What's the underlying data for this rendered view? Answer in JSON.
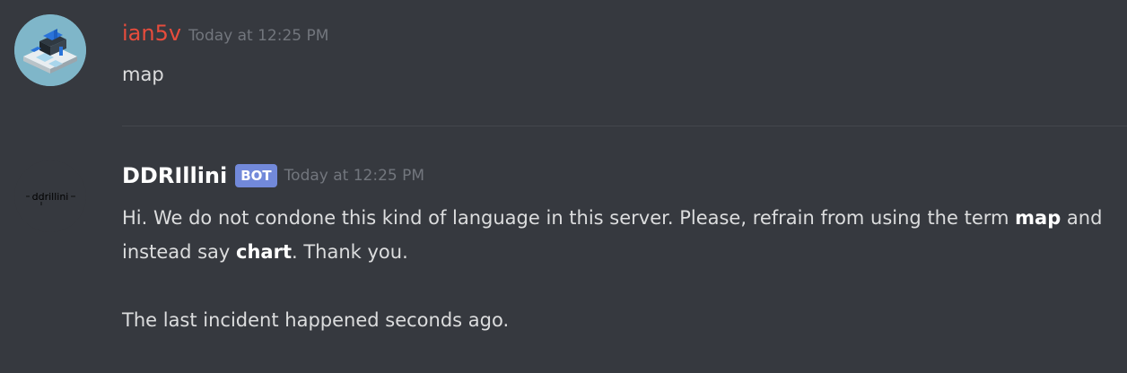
{
  "messages": [
    {
      "username": "ian5v",
      "username_color": "#e74c3c",
      "timestamp": "Today at 12:25 PM",
      "text": "map"
    },
    {
      "username": "DDRIllini",
      "username_color": "#ffffff",
      "badge": "BOT",
      "badge_color": "#7289da",
      "timestamp": "Today at 12:25 PM",
      "line1_a": "Hi. We do not condone this kind of language in this server. Please, refrain from using the term ",
      "bold1": "map",
      "line1_b": " and instead say ",
      "bold2": "chart",
      "line1_c": ". Thank you.",
      "line2": "The last incident happened seconds ago.",
      "avatar_text": "ddrillini"
    }
  ],
  "colors": {
    "background": "#36393f",
    "text": "#dcddde",
    "timestamp": "#72767d"
  },
  "icons": {
    "avatar1": "isometric-building-avatar-icon",
    "avatar2": "ddrillini-logo-avatar-icon"
  }
}
